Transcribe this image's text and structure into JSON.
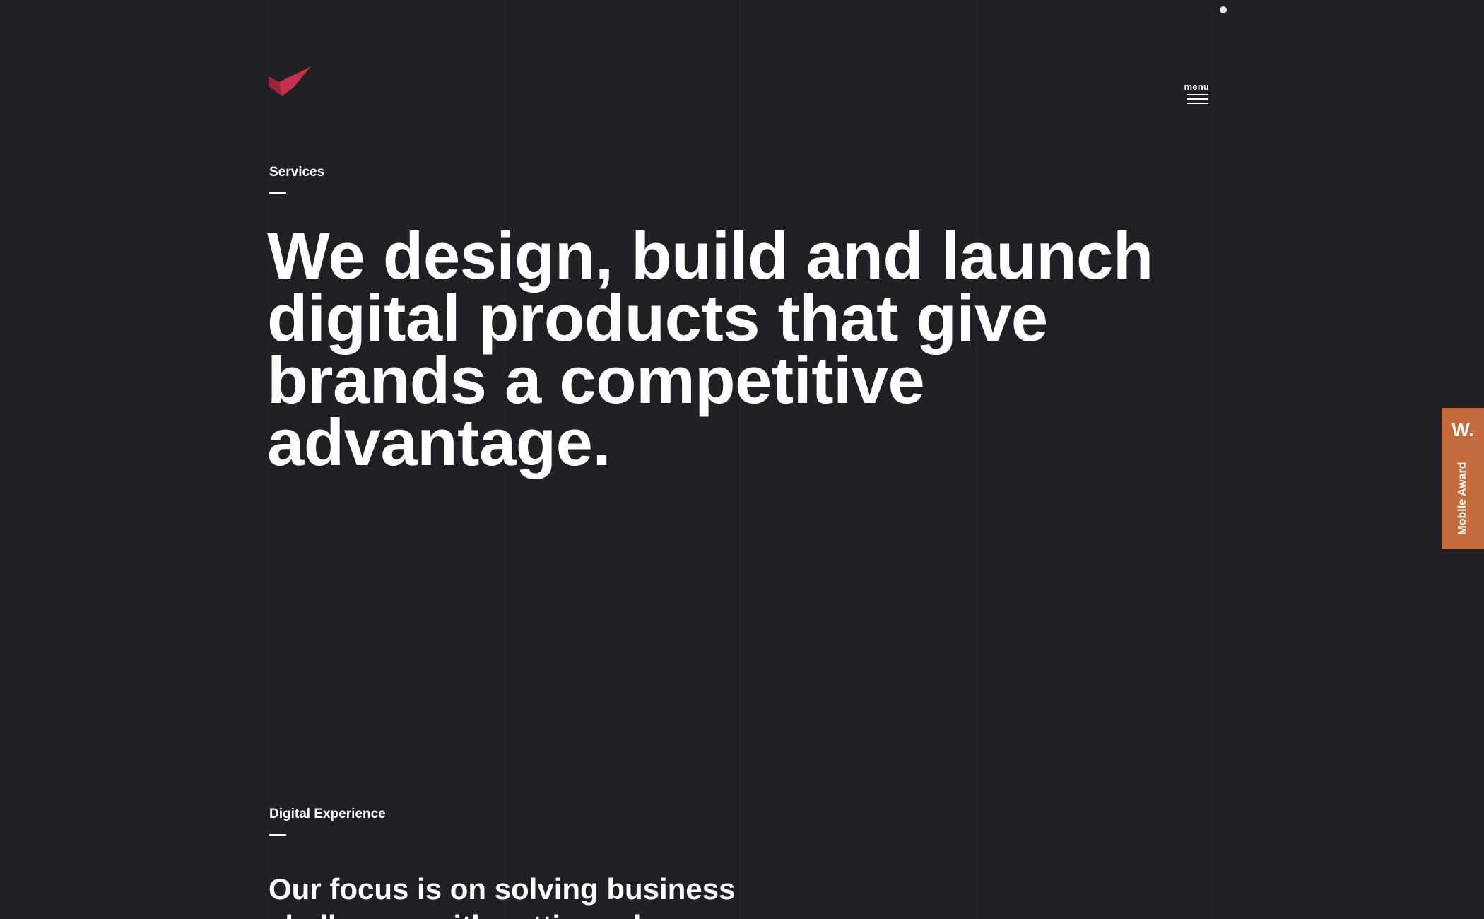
{
  "colors": {
    "background": "#202024",
    "text": "#ffffff",
    "logo_accent": "#c4324a",
    "award_tab": "#c36b3b"
  },
  "header": {
    "logo_icon": "checkmark-logo-icon",
    "menu_label": "menu",
    "menu_icon": "hamburger-icon"
  },
  "services": {
    "label": "Services",
    "headline": "We design, build and launch digital products that give brands a competitive advantage."
  },
  "digital_experience": {
    "label": "Digital Experience",
    "headline": "Our focus is on solving business challenges with cutting-edge"
  },
  "award_tab": {
    "badge": "W.",
    "label": "Mobile Award"
  }
}
